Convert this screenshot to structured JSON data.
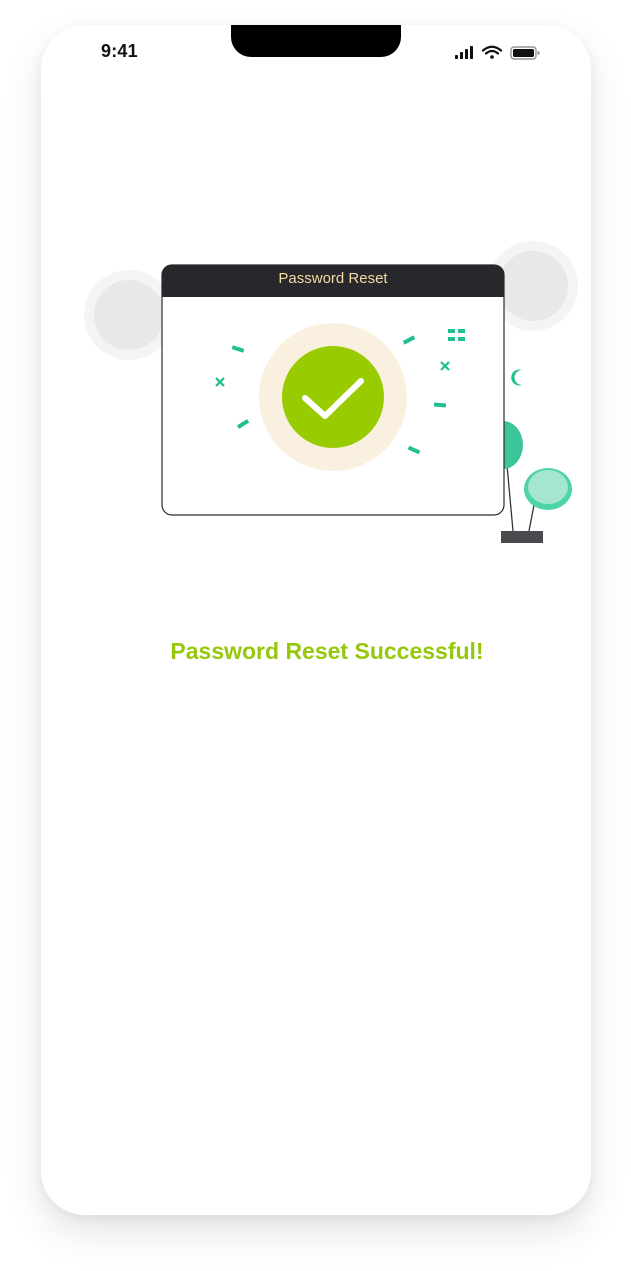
{
  "status_bar": {
    "time": "9:41",
    "icons": [
      "cellular-signal-icon",
      "wifi-icon",
      "battery-icon"
    ]
  },
  "card": {
    "title": "Password Reset"
  },
  "message": {
    "text": "Password Reset Successful!"
  },
  "colors": {
    "accent_green": "#95c80a",
    "check_circle": "#99cc00",
    "halo": "#faf0df",
    "confetti": "#1fbf91",
    "window_header": "#28282c",
    "title_text": "#f3d9a4"
  }
}
